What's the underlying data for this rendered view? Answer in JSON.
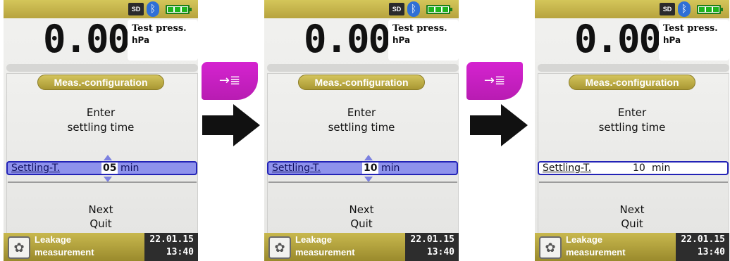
{
  "screens": [
    {
      "status_bar": {
        "sd_label": "SD"
      },
      "value": "0.00",
      "value_label": "Test press.",
      "value_unit": "hPa",
      "header": "Meas.-configuration",
      "prompt_line1": "Enter",
      "prompt_line2": "settling time",
      "field_label": "Settling-T.",
      "field_value": "05",
      "field_unit": "min",
      "menu": [
        "Next",
        "Quit"
      ],
      "footer_line1": "Leakage",
      "footer_line2": "measurement",
      "date": "22.01.15",
      "time": "13:40"
    },
    {
      "status_bar": {
        "sd_label": "SD"
      },
      "value": "0.00",
      "value_label": "Test press.",
      "value_unit": "hPa",
      "header": "Meas.-configuration",
      "prompt_line1": "Enter",
      "prompt_line2": "settling time",
      "field_label": "Settling-T.",
      "field_value": "10",
      "field_unit": "min",
      "menu": [
        "Next",
        "Quit"
      ],
      "footer_line1": "Leakage",
      "footer_line2": "measurement",
      "date": "22.01.15",
      "time": "13:40"
    },
    {
      "status_bar": {
        "sd_label": "SD"
      },
      "value": "0.00",
      "value_label": "Test press.",
      "value_unit": "hPa",
      "header": "Meas.-configuration",
      "prompt_line1": "Enter",
      "prompt_line2": "settling time",
      "field_label": "Settling-T.",
      "field_value": "10",
      "field_unit": "min",
      "menu": [
        "Next",
        "Quit"
      ],
      "footer_line1": "Leakage",
      "footer_line2": "measurement",
      "date": "22.01.15",
      "time": "13:40"
    }
  ],
  "key_button": {
    "icon": "confirm-arrow-icon",
    "glyph": "→≣"
  },
  "colors": {
    "accent_gold": "#c2b24a",
    "selection_blue": "#8e92ec",
    "selection_border": "#2323b6",
    "key_magenta": "#c81fc3"
  }
}
